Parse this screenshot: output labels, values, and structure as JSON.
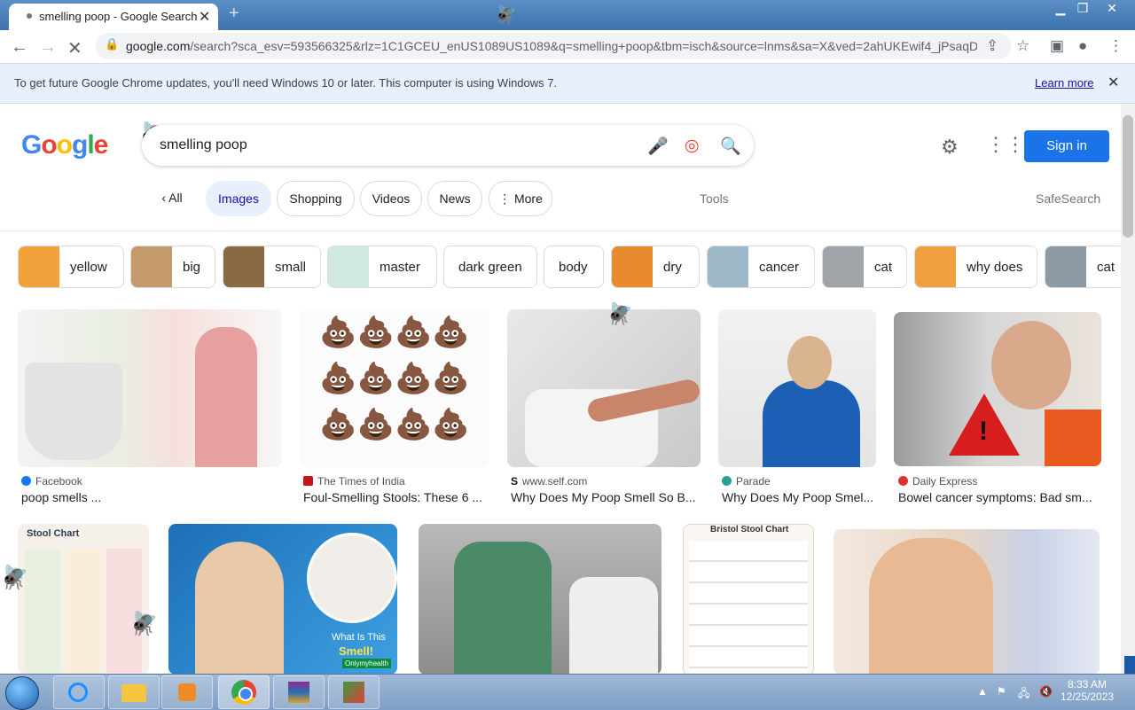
{
  "browser": {
    "tab_title": "smelling poop - Google Search",
    "url_domain": "google.com",
    "url_rest": "/search?sca_esv=593566325&rlz=1C1GCEU_enUS1089US1089&q=smelling+poop&tbm=isch&source=lnms&sa=X&ved=2ahUKEwif4_jPsaqD...",
    "infobar_message": "To get future Google Chrome updates, you'll need Windows 10 or later. This computer is using Windows 7.",
    "infobar_link": "Learn more"
  },
  "search": {
    "logo": "Google",
    "query": "smelling poop",
    "sign_in": "Sign in",
    "tabs": [
      "All",
      "Images",
      "Shopping",
      "Videos",
      "News",
      "More"
    ],
    "tools": "Tools",
    "safesearch": "SafeSearch"
  },
  "chips": [
    "yellow",
    "big",
    "small",
    "master",
    "dark green",
    "body",
    "dry",
    "cancer",
    "cat",
    "why does",
    "cat"
  ],
  "results": [
    {
      "source": "Facebook",
      "caption": "poop smells ...",
      "icon_color": "#1877f2"
    },
    {
      "source": "The Times of India",
      "caption": "Foul-Smelling Stools: These 6 ...",
      "icon_color": "#c4151c"
    },
    {
      "source": "www.self.com",
      "caption": "Why Does My Poop Smell So B...",
      "icon_color": "#111111"
    },
    {
      "source": "Parade",
      "caption": "Why Does My Poop Smel...",
      "icon_color": "#2aa198"
    },
    {
      "source": "Daily Express",
      "caption": "Bowel cancer symptoms: Bad sm...",
      "icon_color": "#d33"
    }
  ],
  "row2": {
    "stool_chart_title": "Stool Chart",
    "ad_text_1": "What Is This",
    "ad_text_2": "Smell!",
    "ad_brand": "Onlymyhealth",
    "bristol_title": "Bristol Stool Chart"
  },
  "taskbar": {
    "time": "8:33 AM",
    "date": "12/25/2023"
  }
}
